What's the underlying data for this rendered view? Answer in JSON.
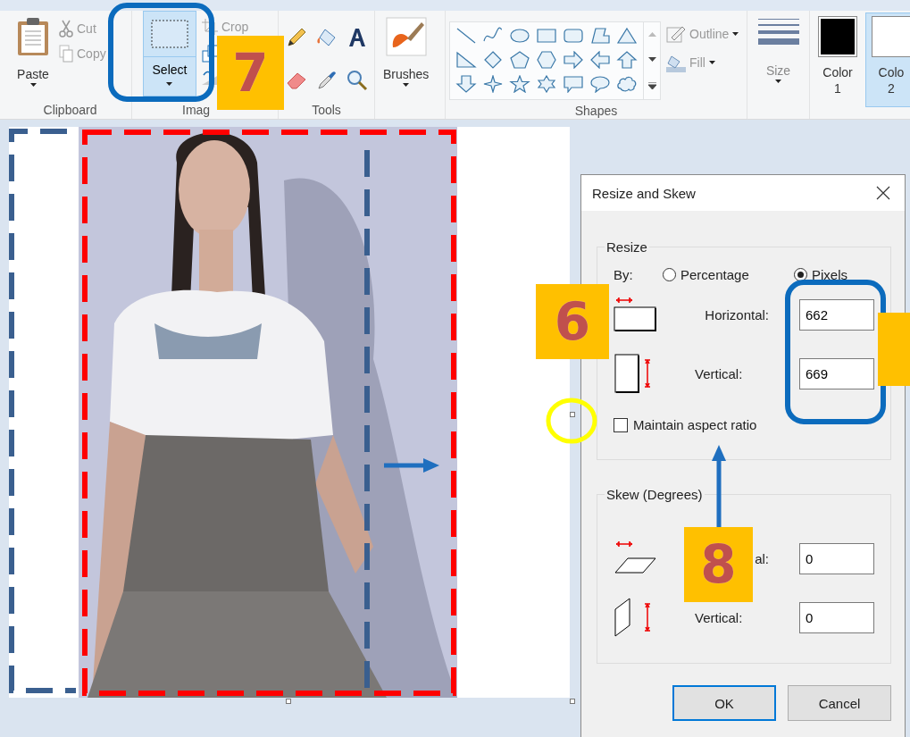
{
  "ribbon": {
    "clipboard": {
      "label": "Clipboard",
      "paste": "Paste",
      "cut": "Cut",
      "copy": "Copy"
    },
    "image": {
      "label": "Imag",
      "select": "Select",
      "select_selected": true,
      "crop": "Crop"
    },
    "tools": {
      "label": "Tools"
    },
    "brushes": {
      "button": "Brushes"
    },
    "shapes": {
      "label": "Shapes",
      "outline": "Outline",
      "fill": "Fill"
    },
    "size": {
      "button": "Size"
    },
    "colors": [
      {
        "label": "Color",
        "number": "1",
        "color": "#000000",
        "selected": false
      },
      {
        "label": "Colo",
        "number": "2",
        "color": "#ffffff",
        "selected": true
      }
    ]
  },
  "dialog": {
    "title": "Resize and Skew",
    "resize": {
      "legend": "Resize",
      "by_label": "By:",
      "options": [
        {
          "label": "Percentage",
          "selected": false
        },
        {
          "label": "Pixels",
          "selected": true
        }
      ],
      "fields": [
        {
          "kind": "horizontal",
          "label": "Horizontal:",
          "value": "662"
        },
        {
          "kind": "vertical",
          "label": "Vertical:",
          "value": "669"
        }
      ],
      "maintain_aspect": {
        "label": "Maintain aspect ratio",
        "checked": false
      }
    },
    "skew": {
      "legend": "Skew (Degrees)",
      "fields": [
        {
          "kind": "horizontal",
          "label": "al:",
          "value": "0"
        },
        {
          "kind": "vertical",
          "label": "Vertical:",
          "value": "0"
        }
      ]
    },
    "buttons": [
      {
        "label": "OK",
        "kind": "default"
      },
      {
        "label": "Cancel",
        "kind": "normal"
      }
    ]
  },
  "annotations": {
    "badges": [
      "7",
      "6",
      "8"
    ]
  }
}
